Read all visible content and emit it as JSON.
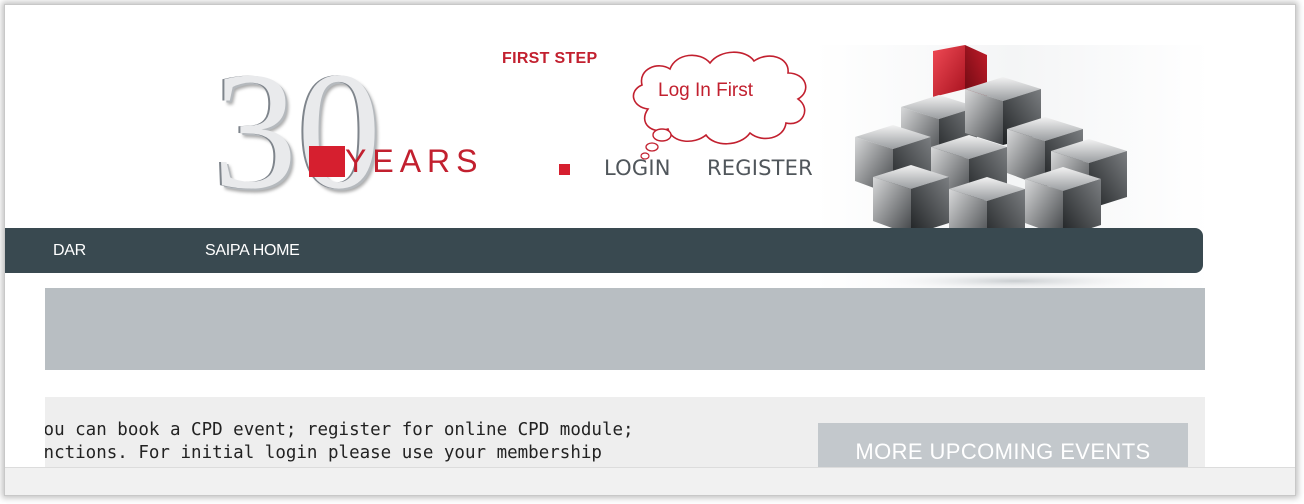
{
  "logo": {
    "digit_three": "3",
    "digit_zero": "0",
    "years_text": "YEARS"
  },
  "annotation": {
    "label": "FIRST STEP",
    "cloud_text": "Log In First"
  },
  "auth": {
    "login": "LOGIN",
    "register": "REGISTER"
  },
  "nav": {
    "items": [
      {
        "label": "DAR"
      },
      {
        "label": "SAIPA HOME"
      }
    ]
  },
  "content": {
    "intro_lines": [
      "You can book a CPD event; register for online CPD module;",
      "unctions. For initial login please use your membership"
    ],
    "events_button": "MORE UPCOMING EVENTS"
  },
  "colors": {
    "accent_red": "#d61f2f",
    "nav_bg": "#394950",
    "band_grey": "#b8bec2",
    "content_bg": "#eeeeee",
    "link_text": "#50565b"
  }
}
